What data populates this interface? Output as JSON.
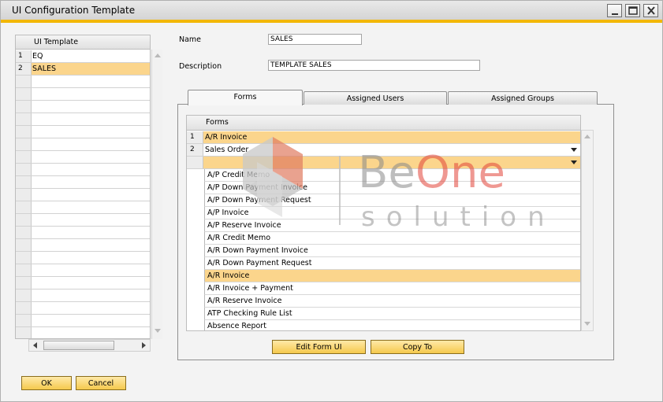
{
  "window": {
    "title": "UI Configuration Template"
  },
  "icons": {
    "minimize": "minimize-icon",
    "maximize": "maximize-icon",
    "close": "close-icon"
  },
  "colors": {
    "accent": "#f2b705",
    "selection": "#fbd58c",
    "button": "#f5c94d"
  },
  "templates": {
    "header": "UI Template",
    "rows": [
      {
        "num": "1",
        "name": "EQ"
      },
      {
        "num": "2",
        "name": "SALES"
      }
    ]
  },
  "form": {
    "name_label": "Name",
    "name_value": "SALES",
    "description_label": "Description",
    "description_value": "TEMPLATE SALES"
  },
  "tabs": [
    {
      "label": "Forms"
    },
    {
      "label": "Assigned Users"
    },
    {
      "label": "Assigned Groups"
    }
  ],
  "forms_table": {
    "header": "Forms",
    "rows": [
      {
        "num": "1",
        "value": "A/R Invoice"
      },
      {
        "num": "2",
        "value": "Sales Order"
      },
      {
        "num": "",
        "value": ""
      }
    ],
    "dropdown_options": [
      "A/P Credit Memo",
      "A/P Down Payment Invoice",
      "A/P Down Payment Request",
      "A/P Invoice",
      "A/P Reserve Invoice",
      "A/R Credit Memo",
      "A/R Down Payment Invoice",
      "A/R Down Payment Request",
      "A/R Invoice",
      "A/R Invoice + Payment",
      "A/R Reserve Invoice",
      "ATP Checking Rule List",
      "Absence Report"
    ]
  },
  "buttons": {
    "edit_form_ui": "Edit Form UI",
    "copy_to": "Copy To",
    "ok": "OK",
    "cancel": "Cancel"
  },
  "watermark": {
    "line1_be": "Be",
    "line1_one": "One",
    "line2": "solution"
  }
}
